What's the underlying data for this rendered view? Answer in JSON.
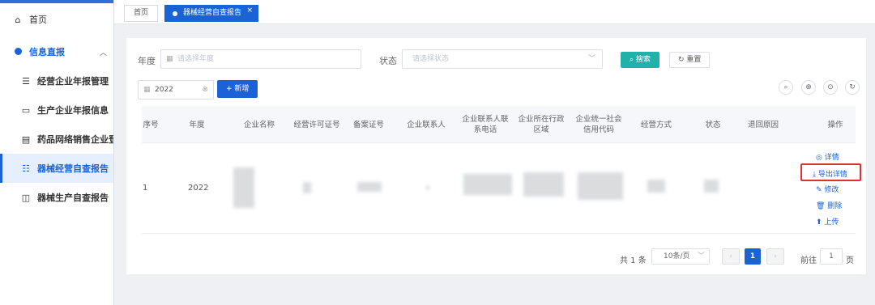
{
  "sidebar": {
    "home": "首页",
    "group": "信息直报",
    "items": [
      "经营企业年报管理",
      "生产企业年报信息",
      "药品网络销售企业登记",
      "器械经营自查报告",
      "器械生产自查报告"
    ]
  },
  "tabs": {
    "home": "首页",
    "active": "器械经营自查报告",
    "close": "×"
  },
  "filters": {
    "year_label": "年度",
    "year_placeholder": "请选择年度",
    "status_label": "状态",
    "status_placeholder": "请选择状态",
    "search": "搜索",
    "reset": "重置",
    "year_value": "2022",
    "add": "+ 新增"
  },
  "table": {
    "headers": [
      "序号",
      "年度",
      "企业名称",
      "经营许可证号",
      "备案证号",
      "企业联系人",
      "企业联系人联系电话",
      "企业所在行政区域",
      "企业统一社会信用代码",
      "经营方式",
      "状态",
      "退回原因",
      "操作"
    ],
    "row": {
      "index": "1",
      "year": "2022"
    },
    "ops": [
      "◎ 详情",
      "⤓ 导出详情",
      "✎ 修改",
      "🗑 删除",
      "⬆ 上传"
    ]
  },
  "pager": {
    "total": "共 1 条",
    "page_size": "10条/页",
    "current": "1",
    "goto": "前往",
    "goto_value": "1",
    "page_unit": "页"
  },
  "colors": {
    "accent": "#1a62d6",
    "teal": "#20b2aa",
    "highlight": "#e03131"
  }
}
